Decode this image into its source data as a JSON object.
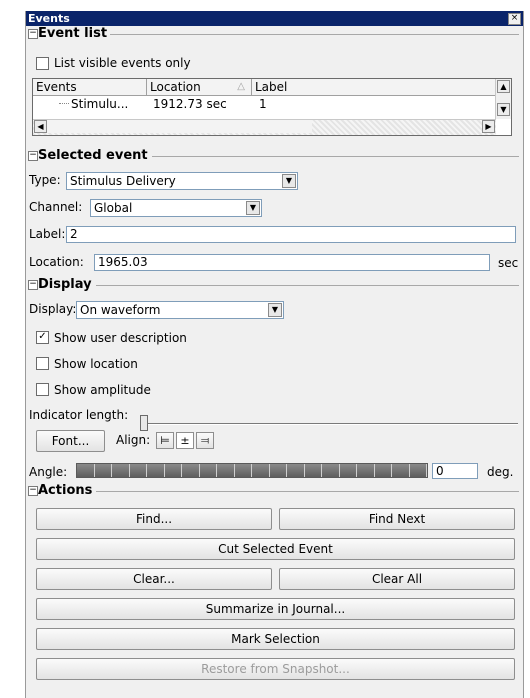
{
  "window": {
    "title": "Events",
    "close_glyph": "×"
  },
  "sections": {
    "event_list": "Event list",
    "selected_event": "Selected event",
    "display": "Display",
    "actions": "Actions"
  },
  "event_list": {
    "visible_only_label": "List visible events only",
    "visible_only_checked": false,
    "columns": [
      "Events",
      "Location",
      "Label"
    ],
    "rows": [
      {
        "event": "Stimulu...",
        "location": "1912.73 sec",
        "label": "1"
      }
    ]
  },
  "selected_event": {
    "type_label": "Type:",
    "type_value": "Stimulus Delivery",
    "channel_label": "Channel:",
    "channel_value": "Global",
    "label_label": "Label:",
    "label_value": "2",
    "location_label": "Location:",
    "location_value": "1965.03",
    "location_unit": "sec"
  },
  "display": {
    "display_label": "Display:",
    "display_value": "On waveform",
    "show_user_description": "Show user description",
    "show_user_description_checked": true,
    "show_location": "Show location",
    "show_location_checked": false,
    "show_amplitude": "Show amplitude",
    "show_amplitude_checked": false,
    "indicator_length_label": "Indicator length:",
    "indicator_length_level": 0,
    "font_button": "Font...",
    "align_label": "Align:",
    "angle_label": "Angle:",
    "angle_value": "0",
    "angle_unit": "deg."
  },
  "actions": {
    "find": "Find...",
    "find_next": "Find Next",
    "cut_selected": "Cut Selected Event",
    "clear": "Clear...",
    "clear_all": "Clear All",
    "summarize": "Summarize in Journal...",
    "mark_selection": "Mark Selection",
    "restore_snapshot": "Restore from Snapshot..."
  }
}
